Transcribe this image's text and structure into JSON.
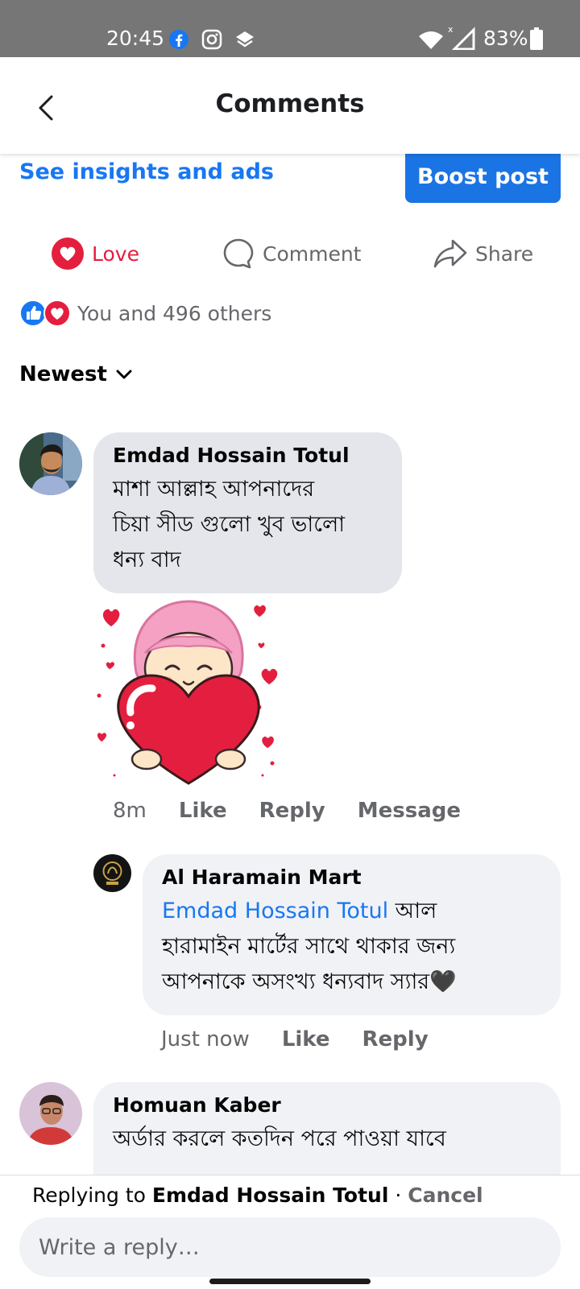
{
  "status_bar": {
    "time": "20:45",
    "battery": "83%",
    "left_icons": [
      "facebook-icon",
      "instagram-icon",
      "layers-icon"
    ],
    "right_icons": [
      "wifi-icon",
      "cell-signal-icon",
      "battery-icon"
    ]
  },
  "header": {
    "title": "Comments",
    "back_icon": "back-arrow-icon"
  },
  "post_bar": {
    "insights_link": "See insights and ads",
    "boost_label": "Boost post"
  },
  "actions": {
    "love": "Love",
    "comment": "Comment",
    "share": "Share"
  },
  "reactions": {
    "summary": "You and 496 others"
  },
  "sort": {
    "label": "Newest"
  },
  "comments": [
    {
      "author": "Emdad Hossain Totul",
      "text_lines": [
        "মাশা আল্লাহ আপনাদের",
        "চিয়া সীড গুলো খুব ভালো",
        "ধন্য বাদ"
      ],
      "sticker": "heart-hug-sticker",
      "time": "8m",
      "like": "Like",
      "reply": "Reply",
      "message": "Message"
    },
    {
      "author": "Al Haramain Mart",
      "mention": "Emdad Hossain Totul",
      "text_lines": [
        " আল",
        "হারামাইন মার্টের সাথে থাকার জন্য",
        "আপনাকে অসংখ্য ধন্যবাদ স্যার🖤"
      ],
      "time": "Just now",
      "like": "Like",
      "reply": "Reply"
    },
    {
      "author": "Homuan Kaber",
      "text_lines": [
        "অর্ডার করলে কতদিন পরে পাওয়া যাবে"
      ]
    }
  ],
  "reply_bar": {
    "prefix": "Replying to ",
    "name": "Emdad Hossain Totul",
    "separator": " · ",
    "cancel": "Cancel",
    "placeholder": "Write a reply…"
  },
  "colors": {
    "accent": "#1877f2",
    "love": "#e41e3f",
    "bubble": "#e4e6eb",
    "reply_bubble": "#f0f2f5"
  }
}
